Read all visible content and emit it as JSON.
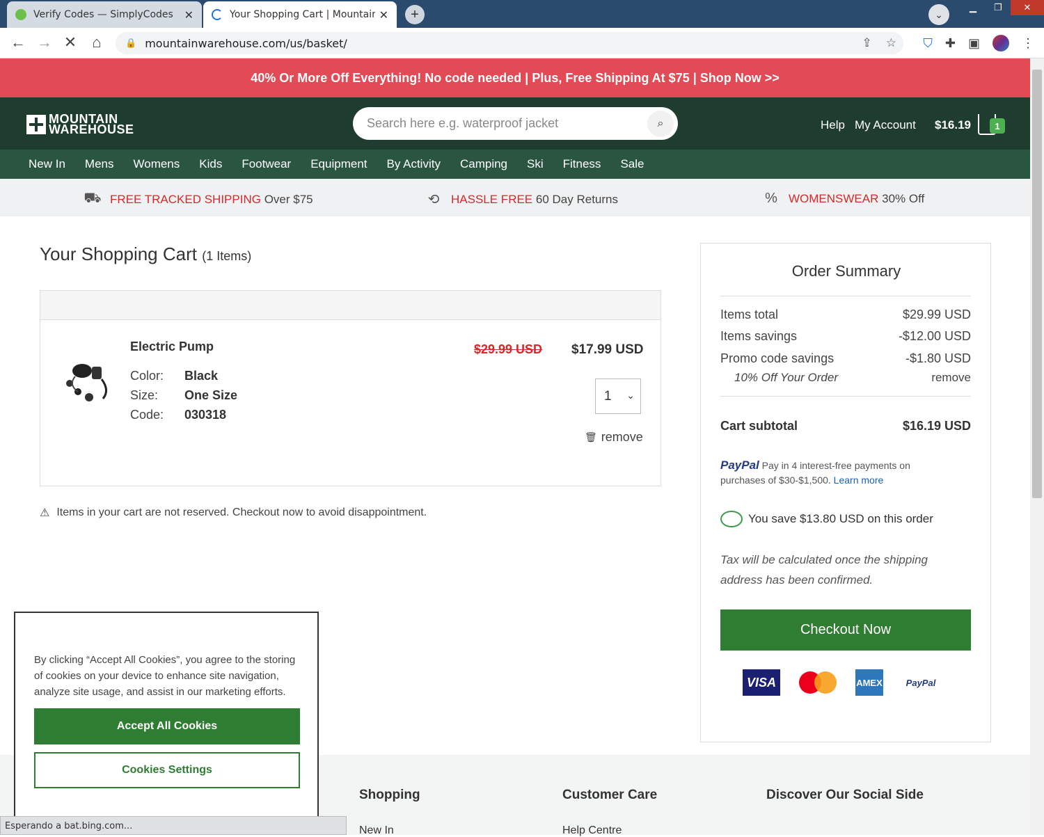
{
  "browser": {
    "tabs": [
      {
        "title": "Verify Codes — SimplyCodes"
      },
      {
        "title": "Your Shopping Cart | Mountain W"
      }
    ],
    "url": "mountainwarehouse.com/us/basket/",
    "status": "Esperando a bat.bing.com..."
  },
  "promo": {
    "text": "40% Or More Off Everything! No code needed | Plus, Free Shipping At $75 | Shop Now >>"
  },
  "header": {
    "logo_line1": "MOUNTAIN",
    "logo_line2": "WAREHOUSE",
    "search_placeholder": "Search here e.g. waterproof jacket",
    "help": "Help",
    "account": "My Account",
    "cart_total": "$16.19",
    "cart_count": "1"
  },
  "nav": [
    "New In",
    "Mens",
    "Womens",
    "Kids",
    "Footwear",
    "Equipment",
    "By Activity",
    "Camping",
    "Ski",
    "Fitness",
    "Sale"
  ],
  "usp": [
    {
      "highlight": "FREE TRACKED SHIPPING",
      "text": "Over $75"
    },
    {
      "highlight": "HASSLE FREE",
      "text": "60 Day Returns"
    },
    {
      "highlight": "WOMENSWEAR",
      "text": "30% Off"
    }
  ],
  "cart": {
    "title": "Your Shopping Cart",
    "count_label": "(1 Items)",
    "item": {
      "name": "Electric Pump",
      "color_label": "Color:",
      "color": "Black",
      "size_label": "Size:",
      "size": "One Size",
      "code_label": "Code:",
      "code": "030318",
      "old_price": "$29.99 USD",
      "price": "$17.99 USD",
      "qty": "1",
      "remove": "remove"
    },
    "notice": "Items in your cart are not reserved. Checkout now to avoid disappointment."
  },
  "summary": {
    "title": "Order Summary",
    "items_total_label": "Items total",
    "items_total": "$29.99 USD",
    "savings_label": "Items savings",
    "savings": "-$12.00 USD",
    "promo_label": "Promo code savings",
    "promo": "-$1.80 USD",
    "promo_code": "10% Off Your Order",
    "promo_remove": "remove",
    "subtotal_label": "Cart subtotal",
    "subtotal": "$16.19 USD",
    "paypal_brand": "PayPal",
    "paypal_text": "Pay in 4 interest-free payments on purchases of $30-$1,500.",
    "paypal_link": "Learn more",
    "you_save": "You save $13.80 USD on this order",
    "tax_note": "Tax will be calculated once the shipping address has been confirmed.",
    "checkout": "Checkout Now",
    "cards": [
      "VISA",
      "Mastercard",
      "AMEX",
      "PayPal"
    ]
  },
  "footer": {
    "cols": [
      "Shopping",
      "Customer Care",
      "Discover Our Social Side"
    ],
    "links": [
      "New In",
      "Help Centre"
    ]
  },
  "cookie": {
    "text": "By clicking “Accept All Cookies”, you agree to the storing of cookies on your device to enhance site navigation, analyze site usage, and assist in our marketing efforts.",
    "accept": "Accept All Cookies",
    "settings": "Cookies Settings"
  }
}
